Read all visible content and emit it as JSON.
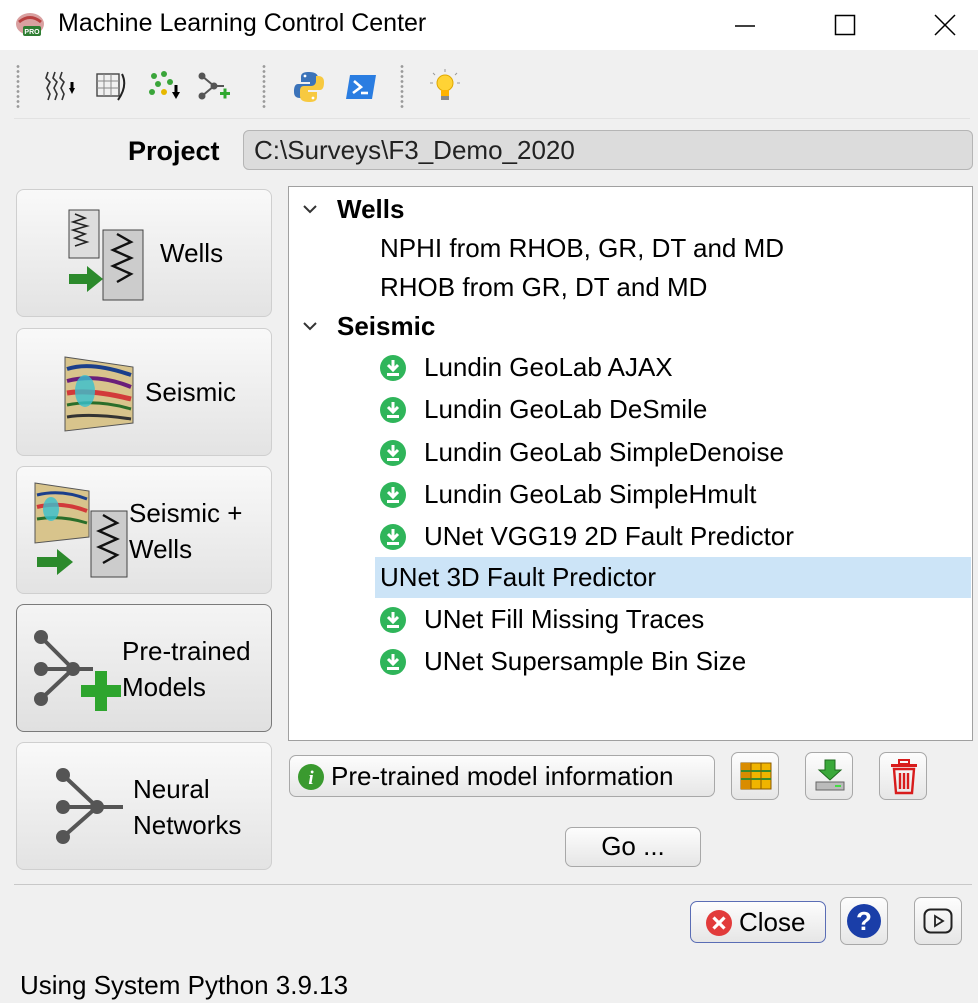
{
  "window": {
    "title": "Machine Learning Control Center",
    "icons": [
      "app-icon",
      "minimize-icon",
      "maximize-icon",
      "close-icon"
    ]
  },
  "toolbar": {
    "icons": [
      "well-logs-import-icon",
      "crossplot-icon",
      "scatter-import-icon",
      "network-add-icon",
      "python-icon",
      "terminal-icon",
      "lightbulb-icon"
    ]
  },
  "project": {
    "label": "Project",
    "path": "C:\\Surveys\\F3_Demo_2020"
  },
  "sidebar": {
    "items": [
      {
        "label": "Wells",
        "icon": "wells-icon"
      },
      {
        "label": "Seismic",
        "icon": "seismic-icon"
      },
      {
        "label": "Seismic +\nWells",
        "icon": "seismic-wells-icon"
      },
      {
        "label": "Pre-trained\nModels",
        "icon": "pretrained-models-icon",
        "selected": true
      },
      {
        "label": "Neural\nNetworks",
        "icon": "neural-networks-icon"
      }
    ]
  },
  "tree": {
    "groups": [
      {
        "title": "Wells",
        "expanded": true,
        "items": [
          {
            "label": "NPHI from RHOB, GR, DT and MD",
            "downloadable": false
          },
          {
            "label": "RHOB from GR, DT and MD",
            "downloadable": false
          }
        ]
      },
      {
        "title": "Seismic",
        "expanded": true,
        "items": [
          {
            "label": "Lundin GeoLab AJAX",
            "downloadable": true
          },
          {
            "label": "Lundin GeoLab DeSmile",
            "downloadable": true
          },
          {
            "label": "Lundin GeoLab SimpleDenoise",
            "downloadable": true
          },
          {
            "label": "Lundin GeoLab SimpleHmult",
            "downloadable": true
          },
          {
            "label": "UNet VGG19 2D Fault Predictor",
            "downloadable": true
          },
          {
            "label": "UNet 3D Fault Predictor",
            "downloadable": false,
            "selected": true
          },
          {
            "label": "UNet Fill Missing Traces",
            "downloadable": true
          },
          {
            "label": "UNet Supersample Bin Size",
            "downloadable": true
          }
        ]
      }
    ]
  },
  "actions": {
    "info_label": "Pre-trained model information",
    "icons": [
      "info-icon",
      "database-icon",
      "download-install-icon",
      "delete-icon"
    ],
    "go_label": "Go ..."
  },
  "footer": {
    "close_label": "Close",
    "icons": [
      "close-circle-icon",
      "help-icon",
      "video-icon"
    ],
    "status": "Using System Python 3.9.13"
  },
  "colors": {
    "selection": "#cce4f7",
    "download_green": "#2fb55a",
    "help_blue": "#1a3ea8",
    "delete_red": "#d81c1c",
    "close_red": "#e23b3b"
  }
}
